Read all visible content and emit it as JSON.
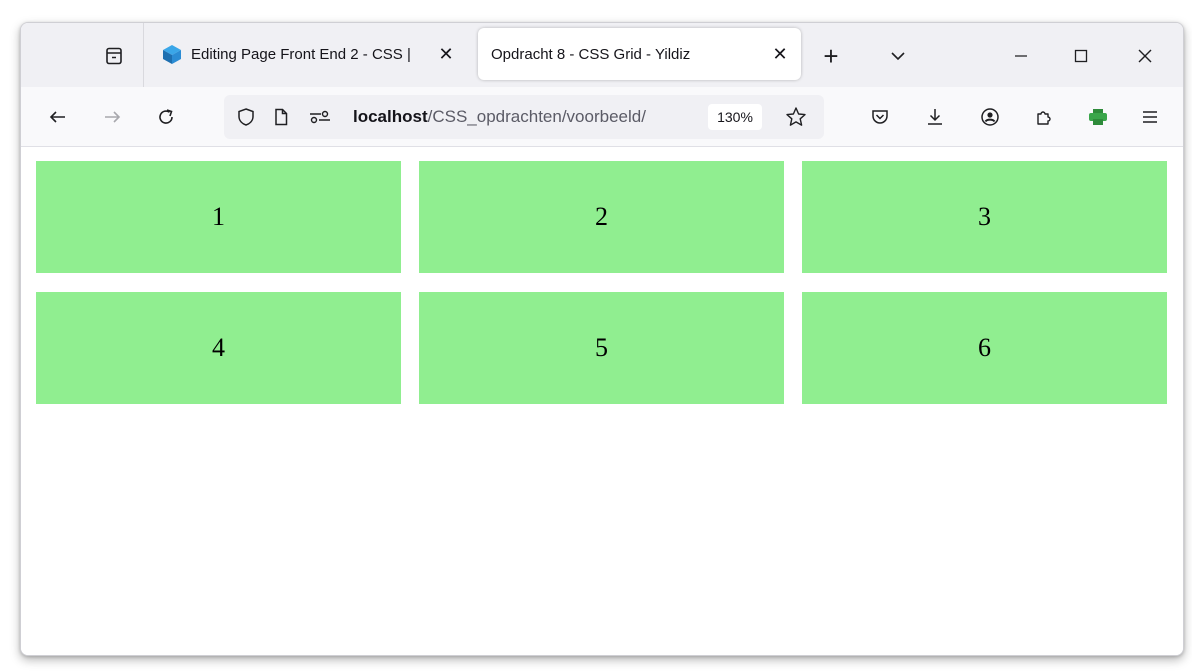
{
  "tabstrip": {
    "tabs": [
      {
        "title": "Editing Page Front End 2 - CSS |",
        "active": false,
        "favicon": "cube-icon"
      },
      {
        "title": "Opdracht 8 - CSS Grid - Yildiz",
        "active": true,
        "favicon": ""
      }
    ],
    "new_tab": "+",
    "tab_list": "chevron-down-icon",
    "window_controls": [
      "minimize-icon",
      "maximize-icon",
      "close-icon"
    ]
  },
  "navbar": {
    "url_host": "localhost",
    "url_path": "/CSS_opdrachten/voorbeeld/",
    "zoom": "130%",
    "buttons": [
      "back-icon",
      "forward-icon",
      "reload-icon",
      "shield-icon",
      "page-icon",
      "permissions-icon",
      "bookmark-star-icon",
      "pocket-icon",
      "download-icon",
      "account-icon",
      "extensions-icon",
      "printer-extension-icon",
      "menu-icon"
    ]
  },
  "grid": {
    "cells": [
      "1",
      "2",
      "3",
      "4",
      "5",
      "6"
    ],
    "cell_color": "#90ee90"
  }
}
